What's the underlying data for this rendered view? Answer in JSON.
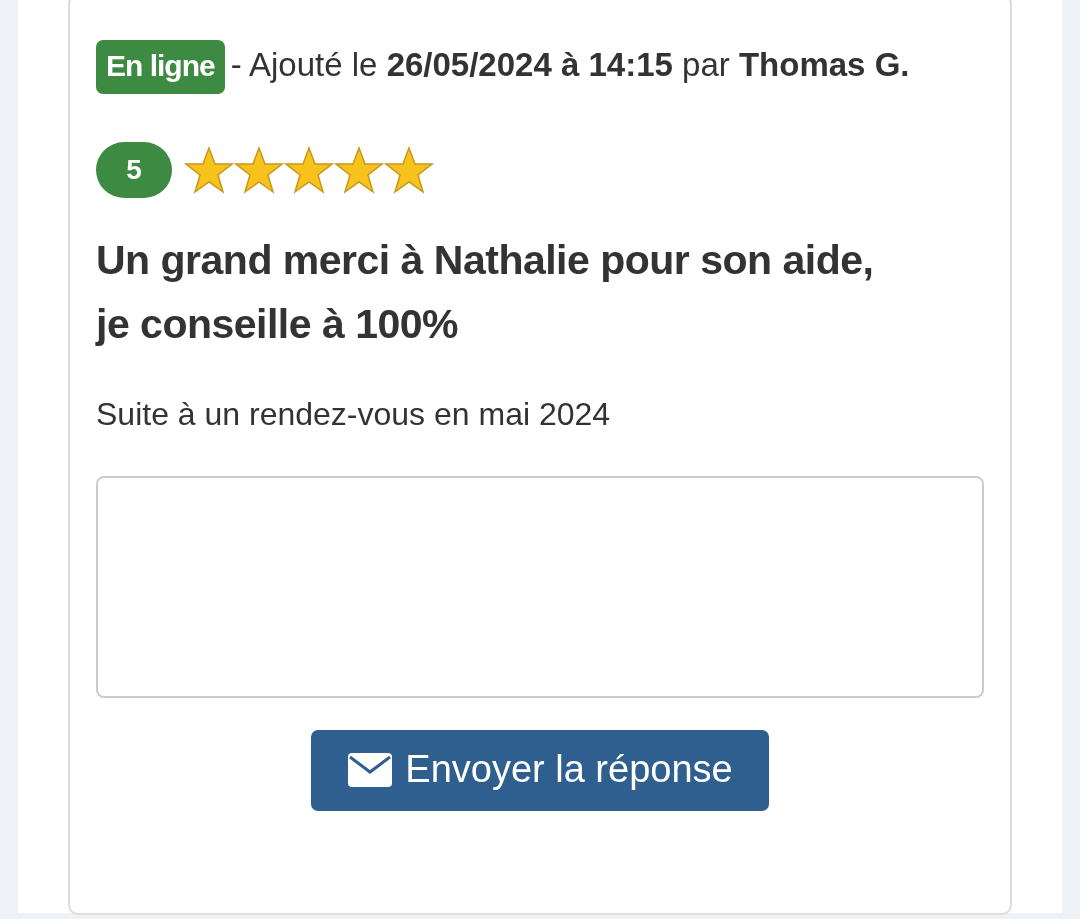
{
  "review": {
    "status_badge": "En ligne",
    "meta": "- Ajouté le **26/05/2024 à 14:15** par **Thomas G.**",
    "rating": "5",
    "stars": 5,
    "title": "Un grand merci à Nathalie pour son aide, je conseille à 100%",
    "context": "Suite à un rendez-vous en mai 2024"
  },
  "reply": {
    "send_button": "Envoyer la réponse"
  }
}
